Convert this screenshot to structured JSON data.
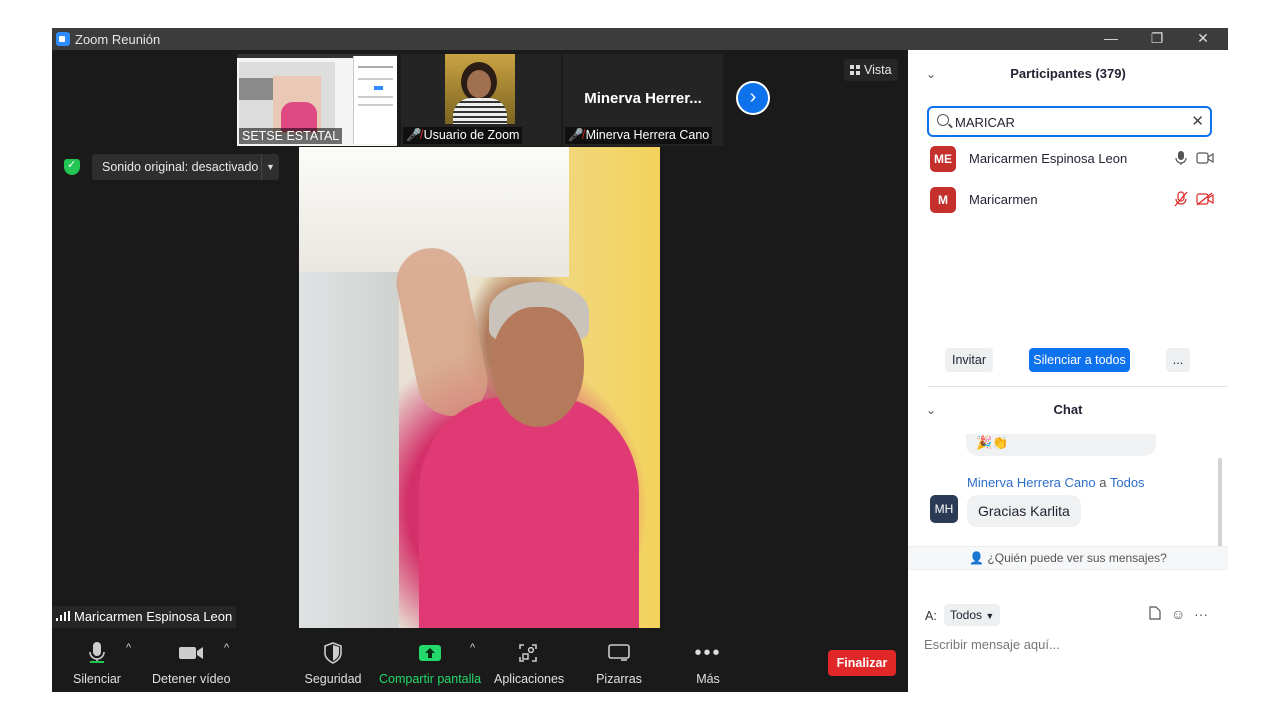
{
  "window": {
    "title": "Zoom Reunión",
    "minimize": "—",
    "restore": "❐",
    "close": "✕"
  },
  "thumbnails": [
    {
      "label": "SETSE ESTATAL",
      "muted": false,
      "kind": "screen"
    },
    {
      "label": "Usuario de Zoom",
      "muted": true,
      "kind": "video"
    },
    {
      "label": "Minerva Herrera Cano",
      "muted": true,
      "kind": "name",
      "display_name": "Minerva  Herrer..."
    }
  ],
  "next_page": "›",
  "view_button": "Vista",
  "original_sound": "Sonido original: desactivado",
  "speaker_name": "Maricarmen Espinosa Leon",
  "toolbar": {
    "mute": "Silenciar",
    "stop_video": "Detener vídeo",
    "security": "Seguridad",
    "share_screen": "Compartir pantalla",
    "apps": "Aplicaciones",
    "whiteboards": "Pizarras",
    "more": "Más",
    "end": "Finalizar"
  },
  "participants": {
    "title": "Participantes (379)",
    "search_value": "MARICAR",
    "items": [
      {
        "initials": "ME",
        "name": "Maricarmen Espinosa Leon",
        "mic_muted": false,
        "video_off": false,
        "avatar_color": "#c4302b"
      },
      {
        "initials": "M",
        "name": "Maricarmen",
        "mic_muted": true,
        "video_off": true,
        "avatar_color": "#c4302b"
      }
    ],
    "invite": "Invitar",
    "mute_all": "Silenciar a todos",
    "more": "..."
  },
  "chat": {
    "title": "Chat",
    "prev_message_emoji": "🎉👏",
    "sender": "Minerva Herrera Cano",
    "sender_connector": "a",
    "recipient": "Todos",
    "sender_initials": "MH",
    "message": "Gracias Karlita",
    "who_can_see": "¿Quién puede ver sus mensajes?",
    "to_label": "A:",
    "to_value": "Todos",
    "placeholder": "Escribir mensaje aquí..."
  },
  "colors": {
    "accent": "#0e72ed",
    "end_red": "#e02828",
    "share_green": "#23d96b",
    "muted_red": "#e02828",
    "sender_blue": "#2d6ec9"
  }
}
